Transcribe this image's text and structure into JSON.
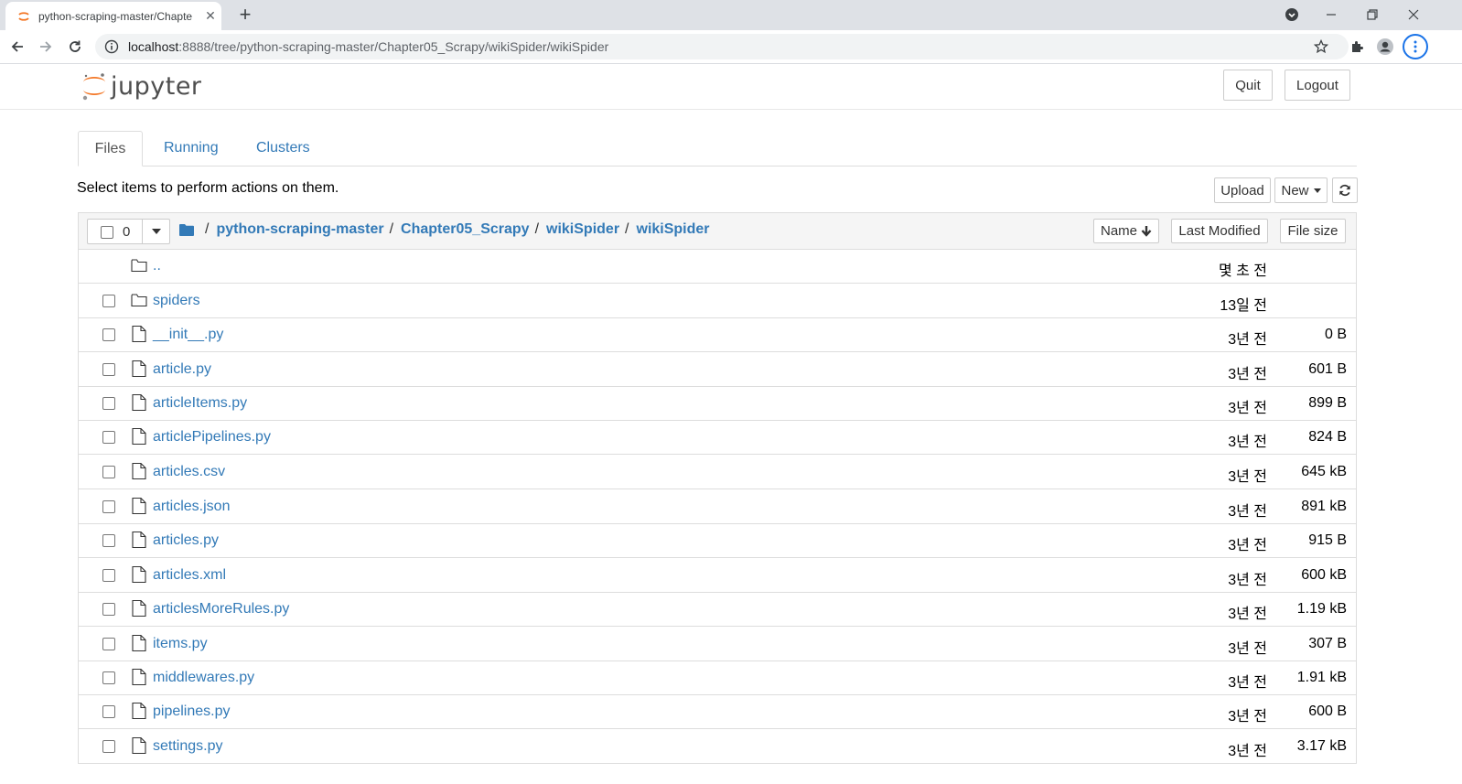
{
  "browser": {
    "tab_title": "python-scraping-master/Chapte",
    "url_host": "localhost",
    "url_rest": ":8888/tree/python-scraping-master/Chapter05_Scrapy/wikiSpider/wikiSpider",
    "accent_color": "#1a73e8"
  },
  "header": {
    "logo_text": "jupyter",
    "quit_label": "Quit",
    "logout_label": "Logout"
  },
  "tabs": [
    {
      "label": "Files",
      "active": true
    },
    {
      "label": "Running",
      "active": false
    },
    {
      "label": "Clusters",
      "active": false
    }
  ],
  "toolbar": {
    "instructions": "Select items to perform actions on them.",
    "upload_label": "Upload",
    "new_label": "New",
    "refresh_icon": "refresh-icon"
  },
  "list_header": {
    "selected_count": "0",
    "breadcrumb": [
      "python-scraping-master",
      "Chapter05_Scrapy",
      "wikiSpider",
      "wikiSpider"
    ],
    "sort_name": "Name",
    "sort_modified": "Last Modified",
    "sort_size": "File size"
  },
  "rows": [
    {
      "name": "..",
      "type": "folder",
      "modified": "몇 초 전",
      "size": "",
      "checkbox": false
    },
    {
      "name": "spiders",
      "type": "folder",
      "modified": "13일 전",
      "size": "",
      "checkbox": true
    },
    {
      "name": "__init__.py",
      "type": "file",
      "modified": "3년 전",
      "size": "0 B",
      "checkbox": true
    },
    {
      "name": "article.py",
      "type": "file",
      "modified": "3년 전",
      "size": "601 B",
      "checkbox": true
    },
    {
      "name": "articleItems.py",
      "type": "file",
      "modified": "3년 전",
      "size": "899 B",
      "checkbox": true
    },
    {
      "name": "articlePipelines.py",
      "type": "file",
      "modified": "3년 전",
      "size": "824 B",
      "checkbox": true
    },
    {
      "name": "articles.csv",
      "type": "file",
      "modified": "3년 전",
      "size": "645 kB",
      "checkbox": true
    },
    {
      "name": "articles.json",
      "type": "file",
      "modified": "3년 전",
      "size": "891 kB",
      "checkbox": true
    },
    {
      "name": "articles.py",
      "type": "file",
      "modified": "3년 전",
      "size": "915 B",
      "checkbox": true
    },
    {
      "name": "articles.xml",
      "type": "file",
      "modified": "3년 전",
      "size": "600 kB",
      "checkbox": true
    },
    {
      "name": "articlesMoreRules.py",
      "type": "file",
      "modified": "3년 전",
      "size": "1.19 kB",
      "checkbox": true
    },
    {
      "name": "items.py",
      "type": "file",
      "modified": "3년 전",
      "size": "307 B",
      "checkbox": true
    },
    {
      "name": "middlewares.py",
      "type": "file",
      "modified": "3년 전",
      "size": "1.91 kB",
      "checkbox": true
    },
    {
      "name": "pipelines.py",
      "type": "file",
      "modified": "3년 전",
      "size": "600 B",
      "checkbox": true
    },
    {
      "name": "settings.py",
      "type": "file",
      "modified": "3년 전",
      "size": "3.17 kB",
      "checkbox": true
    }
  ]
}
